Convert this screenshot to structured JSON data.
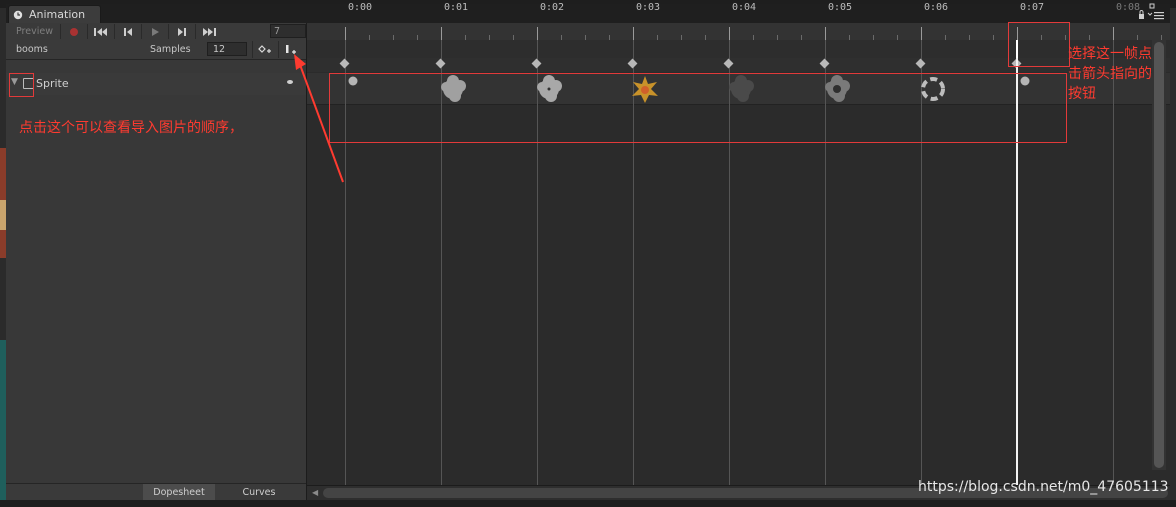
{
  "window": {
    "tab_title": "Animation",
    "tab_icon": "clock-icon"
  },
  "toolbar": {
    "preview_label": "Preview",
    "record_icon": "record-icon",
    "first_frame_icon": "first-frame-icon",
    "prev_frame_icon": "prev-frame-icon",
    "play_icon": "play-icon",
    "next_frame_icon": "next-frame-icon",
    "last_frame_icon": "last-frame-icon",
    "current_frame": "7"
  },
  "clip": {
    "name": "booms",
    "samples_label": "Samples",
    "samples_value": "12",
    "add_keyframe_icon": "add-keyframe-icon",
    "add_event_icon": "add-event-icon"
  },
  "properties": [
    {
      "label": "Sprite",
      "icon": "sprite-icon"
    }
  ],
  "bottom_tabs": {
    "dopesheet": "Dopesheet",
    "curves": "Curves"
  },
  "timeline": {
    "ticks": [
      "0:00",
      "0:01",
      "0:02",
      "0:03",
      "0:04",
      "0:05",
      "0:06",
      "0:07",
      "0:08"
    ],
    "keyframe_sprites": [
      {
        "frame": 0,
        "kind": "small-puff",
        "color": "#b5b5b5"
      },
      {
        "frame": 1,
        "kind": "cloud",
        "color": "#a0a0a0"
      },
      {
        "frame": 2,
        "kind": "cloud-spark",
        "color": "#a8a8a8"
      },
      {
        "frame": 3,
        "kind": "explosion",
        "color": "#c8922a"
      },
      {
        "frame": 4,
        "kind": "smoke-dark",
        "color": "#4a4a4a"
      },
      {
        "frame": 5,
        "kind": "smoke",
        "color": "#7a7a7a"
      },
      {
        "frame": 6,
        "kind": "ring",
        "color": "#bdbdbd"
      },
      {
        "frame": 7,
        "kind": "small-puff",
        "color": "#b5b5b5"
      }
    ],
    "playhead_frame": 7
  },
  "annotations": {
    "left_note": "点击这个可以查看导入图片的顺序，",
    "right_note_lines": [
      "选择这一帧点",
      "击箭头指向的",
      "按钮"
    ],
    "accent_color": "#ff3b30"
  },
  "watermark": "https://blog.csdn.net/m0_47605113"
}
